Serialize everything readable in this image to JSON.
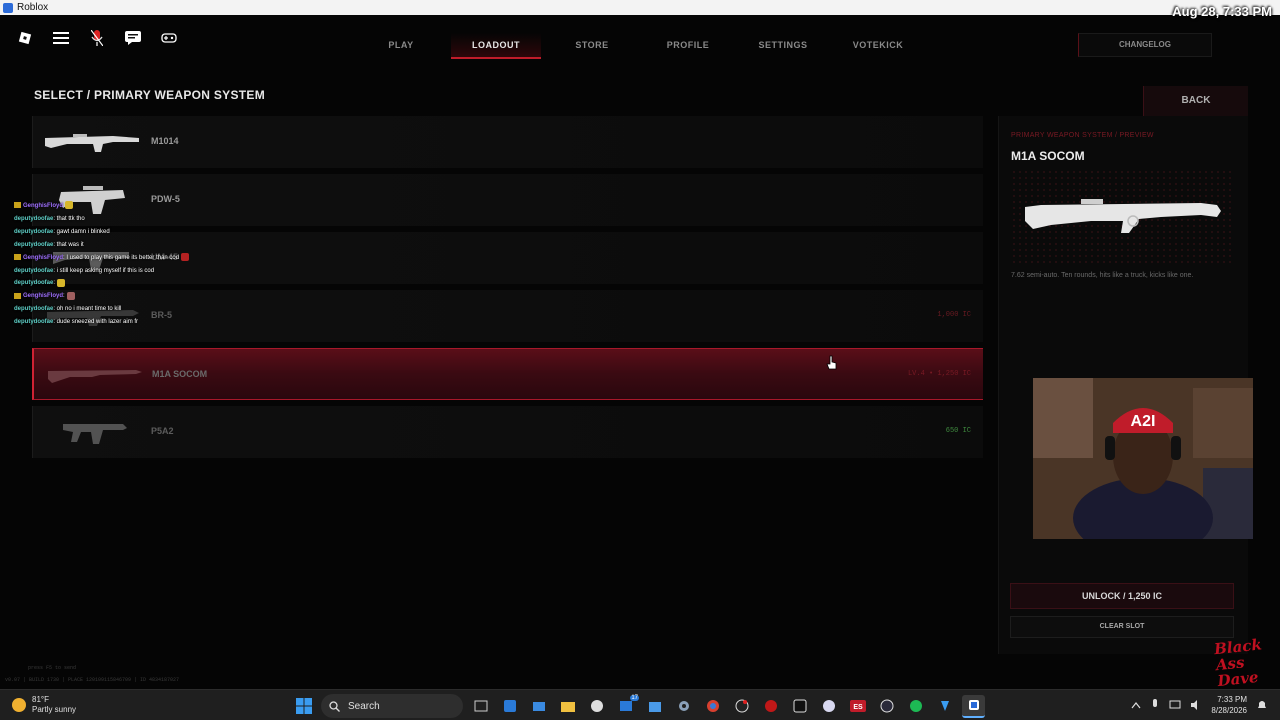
{
  "window": {
    "title": "Roblox",
    "overlay_clock": "Aug 28, 7:33 PM"
  },
  "topbar": {
    "icons": [
      "roblox-logo-icon",
      "menu-icon",
      "microphone-icon",
      "chat-icon",
      "controller-icon"
    ],
    "tabs": [
      {
        "label": "PLAY",
        "active": false
      },
      {
        "label": "LOADOUT",
        "active": true
      },
      {
        "label": "STORE",
        "active": false
      },
      {
        "label": "PROFILE",
        "active": false
      },
      {
        "label": "SETTINGS",
        "active": false
      },
      {
        "label": "VOTEKICK",
        "active": false
      }
    ],
    "changelog_label": "CHANGELOG"
  },
  "section_title": "SELECT / PRIMARY WEAPON SYSTEM",
  "weapons": [
    {
      "name": "M1014",
      "price": "",
      "state": "owned"
    },
    {
      "name": "PDW-5",
      "price": "",
      "state": "owned"
    },
    {
      "name": "UM-45",
      "price": "",
      "state": "owned"
    },
    {
      "name": "BR-5",
      "price": "1,000 IC",
      "state": "locked"
    },
    {
      "name": "M1A SOCOM",
      "price": "LV.4 • 1,250 IC",
      "state": "selected"
    },
    {
      "name": "P5A2",
      "price": "650 IC",
      "state": "cost"
    }
  ],
  "chat": [
    {
      "user": "GenghisFloyd",
      "message": "",
      "badge": true,
      "purple": true,
      "emote": "y"
    },
    {
      "user": "deputydoofae",
      "message": ": that ttk tho"
    },
    {
      "user": "deputydoofae",
      "message": ": gawt damn i blinked"
    },
    {
      "user": "deputydoofae",
      "message": ": that was it"
    },
    {
      "user": "GenghisFloyd",
      "message": ": I used to play this game its better than cod",
      "badge": true,
      "purple": true,
      "emote": "r"
    },
    {
      "user": "deputydoofae",
      "message": ": i still keep asking myself if this is cod"
    },
    {
      "user": "deputydoofae",
      "message": ":",
      "emote": "y"
    },
    {
      "user": "GenghisFloyd",
      "message": ":",
      "badge": true,
      "purple": true,
      "emote": "p"
    },
    {
      "user": "deputydoofae",
      "message": ": oh no i meant time to kill"
    },
    {
      "user": "deputydoofae",
      "message": ": dude sneezed with lazer aim fr"
    }
  ],
  "preview": {
    "back_label": "BACK",
    "crumb": "PRIMARY WEAPON SYSTEM / PREVIEW",
    "title": "M1A SOCOM",
    "description": "7.62 semi-auto. Ten rounds, hits like a truck, kicks like one.",
    "unlock_label": "UNLOCK / 1,250 IC",
    "clear_label": "CLEAR SLOT"
  },
  "build_info": "v0.07 | BUILD 1730 | PLACE 120109115846709 | ID 4834187027",
  "build_info_top": "press F5 to send",
  "watermark": "Black Ass Dave",
  "taskbar": {
    "weather_temp": "81°F",
    "weather_desc": "Partly sunny",
    "search_placeholder": "Search",
    "time": "7:33 PM",
    "date": "8/28/2026",
    "notification_badge": "17"
  },
  "colors": {
    "accent": "#c01c2a",
    "selected_row": "#3a0a12",
    "cost_green": "#3f8a3f"
  }
}
